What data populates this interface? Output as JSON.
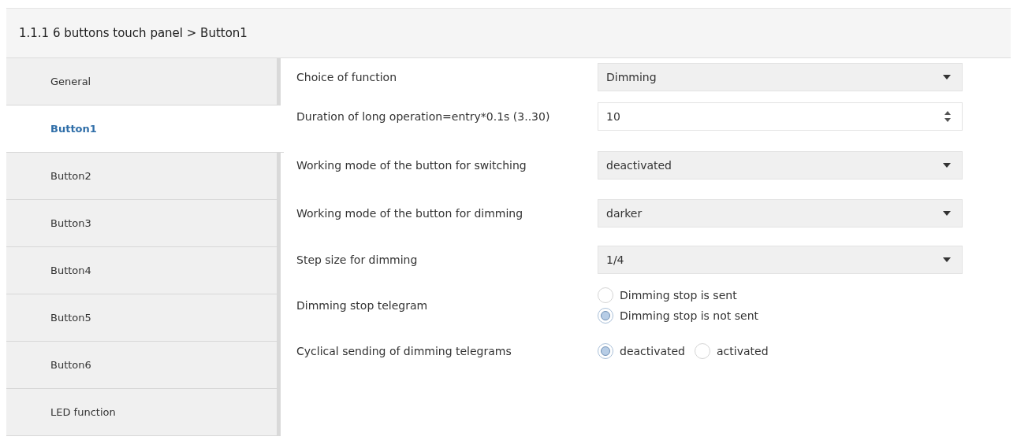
{
  "header": {
    "title": "1.1.1 6 buttons touch panel > Button1"
  },
  "sidebar": {
    "items": [
      {
        "label": "General",
        "selected": false
      },
      {
        "label": "Button1",
        "selected": true
      },
      {
        "label": "Button2",
        "selected": false
      },
      {
        "label": "Button3",
        "selected": false
      },
      {
        "label": "Button4",
        "selected": false
      },
      {
        "label": "Button5",
        "selected": false
      },
      {
        "label": "Button6",
        "selected": false
      },
      {
        "label": "LED function",
        "selected": false
      }
    ]
  },
  "parameters": [
    {
      "kind": "dropdown",
      "label": "Choice of function",
      "value": "Dimming"
    },
    {
      "kind": "spinner",
      "label": "Duration of long operation=entry*0.1s (3..30)",
      "value": "10"
    },
    {
      "kind": "dropdown",
      "label": "Working mode of the button for switching",
      "value": "deactivated"
    },
    {
      "kind": "dropdown",
      "label": "Working mode of the button for dimming",
      "value": "darker"
    },
    {
      "kind": "dropdown",
      "label": "Step size for dimming",
      "value": "1/4"
    },
    {
      "kind": "radio_vertical",
      "label": "Dimming stop telegram",
      "options": [
        {
          "label": "Dimming stop is sent",
          "selected": false
        },
        {
          "label": "Dimming stop is not sent",
          "selected": true
        }
      ]
    },
    {
      "kind": "radio_horizontal",
      "label": "Cyclical sending of dimming telegrams",
      "options": [
        {
          "label": "deactivated",
          "selected": true
        },
        {
          "label": "activated",
          "selected": false
        }
      ]
    }
  ]
}
